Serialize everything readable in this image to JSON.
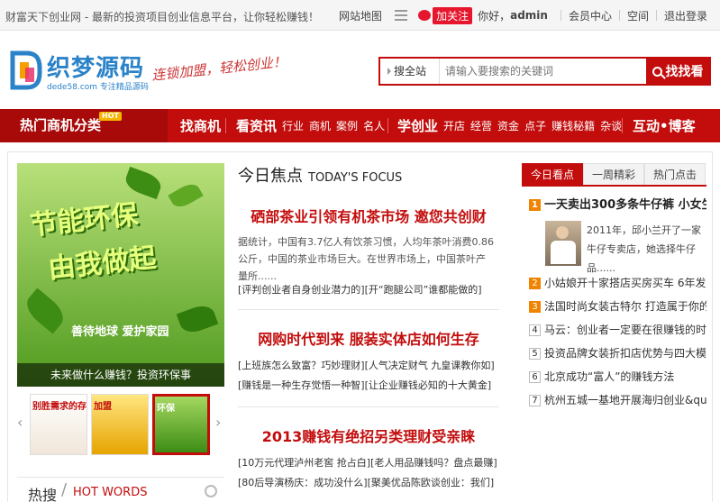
{
  "topbar": {
    "slogan": "财富天下创业网 - 最新的投资项目创业信息平台，让你轻松赚钱！",
    "sitemap": "网站地图",
    "follow": "加关注",
    "greeting": "你好，",
    "username": "admin",
    "member_center": "会员中心",
    "space": "空间",
    "logout": "退出登录"
  },
  "header": {
    "logo_name": "织梦源码",
    "logo_sub": "dede58.com  专注精品源码",
    "tagline": "连锁加盟，轻松创业！",
    "search_scope": "搜全站",
    "search_placeholder": "请输入要搜索的关键词",
    "search_button": "找找看"
  },
  "nav": {
    "hot_category": "热门商机分类",
    "hot_badge": "HOT",
    "find_biz": "找商机",
    "news": "看资讯",
    "news_items": [
      "行业",
      "商机",
      "案例",
      "名人"
    ],
    "learn": "学创业",
    "learn_items": [
      "开店",
      "经营",
      "资金",
      "点子",
      "赚钱秘籍",
      "杂谈"
    ],
    "blog": "互动•博客"
  },
  "slider": {
    "line1": "节能环保",
    "line2": "由我做起",
    "slogan": "善待地球  爱护家园",
    "caption": "未来做什么赚钱？投资环保事",
    "thumb1": "别胜需求的存在",
    "thumb2": "加盟",
    "thumb3": "环保"
  },
  "hot_words": {
    "cn": "热搜",
    "en": "HOT WORDS"
  },
  "focus": {
    "title_cn": "今日焦点",
    "title_en": "TODAY'S FOCUS",
    "stories": [
      {
        "title": "硒部茶业引领有机茶市场 邀您共创财",
        "summary": "据统计，中国有3.7亿人有饮茶习惯，人均年茶叶消费0.86公斤，中国的茶业市场巨大。在世界市场上，中国茶叶产量所......",
        "links": [
          [
            "[评判创业者自身创业潜力的]",
            "[开“跑腿公司”谁都能做的]"
          ]
        ]
      },
      {
        "title": "网购时代到来 服装实体店如何生存",
        "links": [
          [
            "[上班族怎么致富？巧妙理财]",
            "[人气决定财气 九皇课教你如]"
          ],
          [
            "[赚钱是一种生存觉悟一种智]",
            "[让企业赚钱必知的十大黄金]"
          ]
        ]
      },
      {
        "title": "2013赚钱有绝招另类理财受亲睐",
        "links": [
          [
            "[10万元代理泸州老窖 抢占白]",
            "[老人用品赚钱吗？盘点最赚]"
          ],
          [
            "[80后导演杨庆：成功没什么]",
            "[聚美优品陈欧谈创业：我们]"
          ]
        ]
      }
    ]
  },
  "right": {
    "tabs": [
      "今日看点",
      "一周精彩",
      "热门点击"
    ],
    "top_item": "一天卖出300多条牛仔裤 小女生",
    "feature_text": "2011年，邱小兰开了一家牛仔专卖店，她选择牛仔品......",
    "items": [
      "小姑娘开十家搭店买房买车 6年发展",
      "法国时尚女装古特尔 打造属于你的",
      "马云：创业者一定要在很赚钱的时",
      "投资品牌女装折扣店优势与四大模",
      "北京成功“富人”的赚钱方法",
      "杭州五城一基地开展海归创业&quo"
    ],
    "numbers": [
      "1",
      "2",
      "3",
      "4",
      "5",
      "6",
      "7"
    ]
  }
}
